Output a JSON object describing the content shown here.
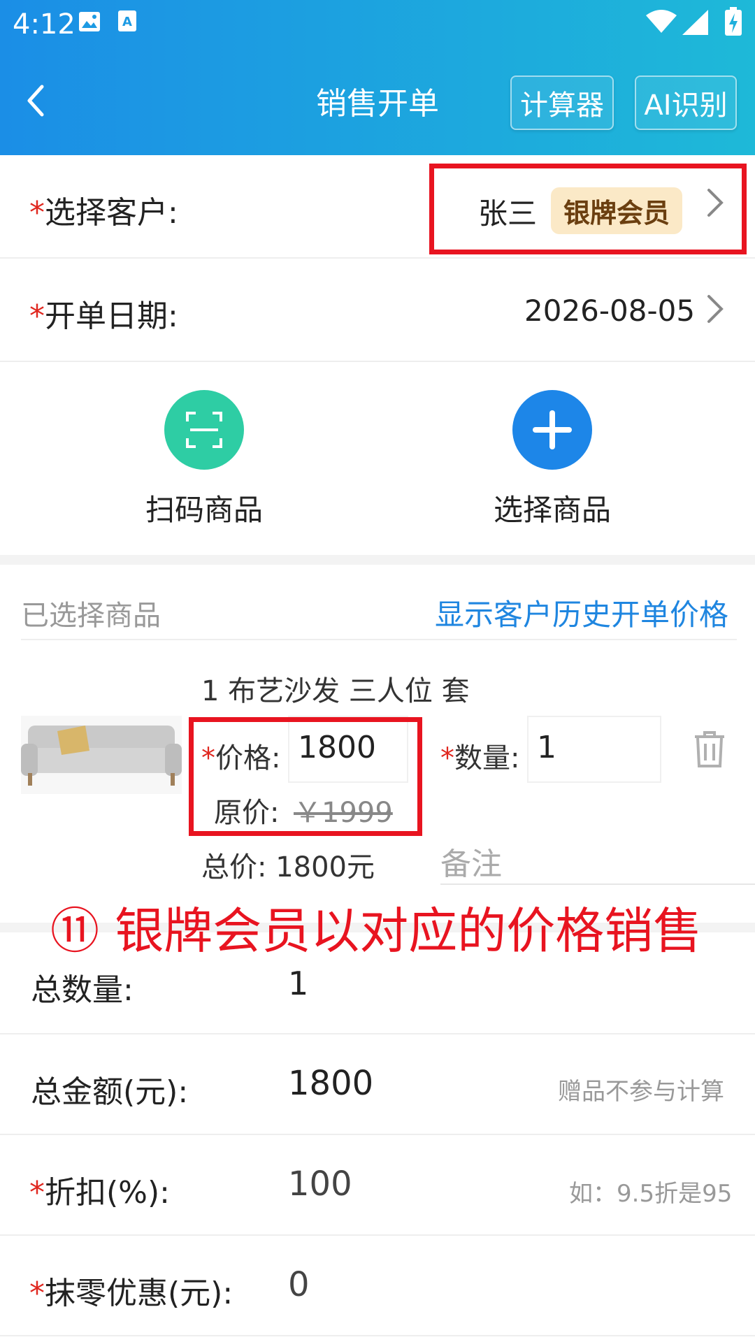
{
  "status": {
    "time": "4:12"
  },
  "header": {
    "title": "销售开单",
    "calculator_label": "计算器",
    "ai_label": "AI识别"
  },
  "customer": {
    "label": "选择客户:",
    "required_mark": "*",
    "name": "张三",
    "badge": "银牌会员"
  },
  "date": {
    "label": "开单日期:",
    "required_mark": "*",
    "value": "2026-08-05"
  },
  "actions": {
    "scan_label": "扫码商品",
    "select_label": "选择商品"
  },
  "selected": {
    "title": "已选择商品",
    "history_link": "显示客户历史开单价格"
  },
  "product": {
    "name": "1 布艺沙发 三人位 套",
    "price_label": "价格:",
    "price_value": "1800",
    "original_label": "原价:",
    "original_value": "￥1999",
    "qty_label": "数量:",
    "qty_value": "1",
    "total_label": "总价:",
    "total_value": "1800元",
    "remark_placeholder": "备注"
  },
  "annotation": "⑪ 银牌会员以对应的价格销售",
  "summary": {
    "total_qty_label": "总数量:",
    "total_qty_value": "1",
    "total_amount_label": "总金额(元):",
    "total_amount_value": "1800",
    "total_amount_hint": "赠品不参与计算",
    "discount_label": "折扣(%):",
    "discount_value": "100",
    "discount_hint": "如：9.5折是95",
    "rounding_label": "抹零优惠(元):",
    "rounding_value": "0"
  },
  "colors": {
    "header_start": "#1b8ee6",
    "header_end": "#1eb9d8",
    "scan_green": "#2ecda4",
    "select_blue": "#1d86e8",
    "link_blue": "#1f86e0",
    "required_red": "#e0271f",
    "annotation_red": "#e81420",
    "badge_bg": "#fbe9c7"
  }
}
